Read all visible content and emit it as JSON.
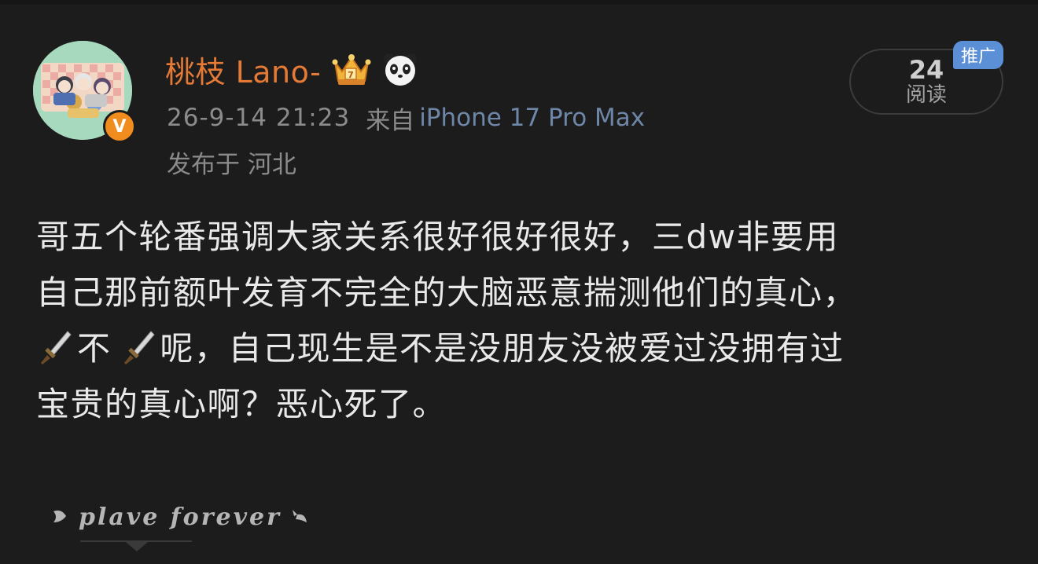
{
  "post": {
    "author": {
      "name": "桃枝 Lano-",
      "verified_mark": "V",
      "badges": [
        "crown-icon",
        "panda-icon"
      ]
    },
    "time": "26-9-14 21:23",
    "from_label": "来自",
    "device": "iPhone 17 Pro Max",
    "location": "发布于 河北",
    "reads": {
      "count": "24",
      "label": "阅读"
    },
    "promo_tag": "推广",
    "text_lines": [
      "哥五个轮番强调大家关系很好很好很好，三dw非要用",
      "自己那前额叶发育不完全的大脑恶意揣测他们的真心，",
      "呢，自己现生是不是没朋友没被爱过没拥有过",
      "宝贵的真心啊？恶心死了。"
    ],
    "line3_mid": "不",
    "signature": "plave forever"
  },
  "colors": {
    "background": "#1c1c1c",
    "username": "#e57a36",
    "device_link": "#6e86a8",
    "meta": "#8b8b8b",
    "promo": "#5b8fd6",
    "verified": "#f18d1e"
  }
}
